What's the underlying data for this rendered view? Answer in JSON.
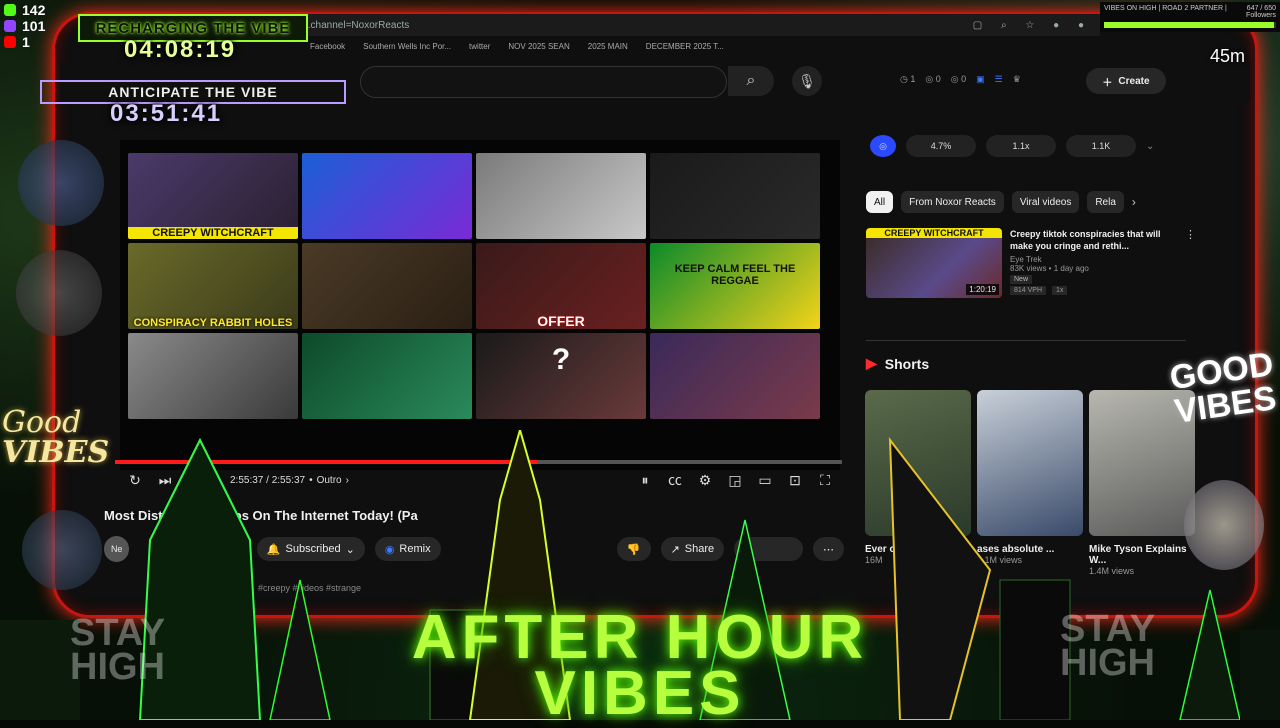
{
  "stream": {
    "viewer_counts": [
      "142",
      "101",
      "1"
    ],
    "recharging_label": "RECHARGING THE VIBE",
    "recharging_timer": "04:08:19",
    "anticipate_label": "ANTICIPATE THE VIBE",
    "anticipate_timer": "03:51:41",
    "minutes_label": "45m",
    "top_right_text": "VIBES ON HIGH | ROAD 2 PARTNER |",
    "top_right_followers": "647 / 650 Followers",
    "good_vibes_left": [
      "Good",
      "VIBES"
    ],
    "good_vibes_right": [
      "GOOD",
      "VIBES"
    ],
    "after_hours": [
      "AFTER HOUR",
      "VIBES"
    ],
    "stay_high_left": [
      "STAY",
      "HIGH"
    ],
    "stay_high_right": [
      "STAY",
      "HIGH"
    ]
  },
  "browser": {
    "url": "ld.channel=NoxorReacts",
    "bookmarks": [
      "Facebook",
      "Southern Wells Inc Por...",
      "twitter",
      "NOV 2025 SEAN",
      "2025 MAIN",
      "DECEMBER 2025 T..."
    ]
  },
  "youtube": {
    "header_stats": [
      "1",
      "0",
      "0"
    ],
    "create_label": "Create",
    "video_grid": [
      {
        "caption": "CREEPY WITCHCRAFT",
        "colors": [
          "#4a3a6a",
          "#2a2030"
        ]
      },
      {
        "caption": "",
        "colors": [
          "#1b5fd6",
          "#7a2ad6"
        ]
      },
      {
        "caption": "",
        "colors": [
          "#7a7a7a",
          "#c8c8c8"
        ]
      },
      {
        "caption": "",
        "colors": [
          "#1a1a1a",
          "#2a2a2a"
        ]
      },
      {
        "caption": "CONSPIRACY RABBIT HOLES",
        "colors": [
          "#6a6a2a",
          "#3a3a1a"
        ]
      },
      {
        "caption": "",
        "colors": [
          "#4a3a26",
          "#2a1f14"
        ]
      },
      {
        "caption": "OFFER",
        "colors": [
          "#3a1a1a",
          "#6a2020"
        ]
      },
      {
        "caption": "KEEP CALM FEEL THE REGGAE",
        "colors": [
          "#0b8a2a",
          "#f4d31a"
        ]
      },
      {
        "caption": "",
        "colors": [
          "#8a8a8a",
          "#3a3a3a"
        ]
      },
      {
        "caption": "",
        "colors": [
          "#0d4a2a",
          "#2a8a5a"
        ]
      },
      {
        "caption": "?",
        "colors": [
          "#1a1a1a",
          "#6a3a3a"
        ]
      },
      {
        "caption": "",
        "colors": [
          "#3a2a5a",
          "#7a3a4a"
        ]
      }
    ],
    "time_display": "2:55:37 / 2:55:37",
    "chapter": "Outro",
    "progress_fraction": 0.58,
    "video_title": "Most Disturbing Videos On The Internet Today! (Pa",
    "channel_initial": "Ne",
    "subscribed_label": "Subscribed",
    "remix_label": "Remix",
    "share_label": "Share",
    "hashtags": "#creepy #videos #strange",
    "right_stats": [
      "4.7%",
      "1.1x",
      "1.1K"
    ],
    "chips": [
      "All",
      "From Noxor Reacts",
      "Viral videos",
      "Rela"
    ],
    "recommended": {
      "caption": "CREEPY WITCHCRAFT",
      "title": "Creepy tiktok conspiracies that will make you cringe and rethi...",
      "channel": "Eye Trek",
      "meta": "83K views • 1 day ago",
      "badge": "New",
      "duration": "1:20:19",
      "extra": "814 VPH",
      "extra2": "1x"
    },
    "shorts_label": "Shorts",
    "shorts": [
      {
        "title": "Ever could...",
        "views": "16M",
        "colors": [
          "#5a6a4a",
          "#2a3a2a"
        ]
      },
      {
        "title": "ases absolute ...",
        "views": "4.1M views",
        "colors": [
          "#c8d0d8",
          "#3a4a6a"
        ]
      },
      {
        "title": "Mike Tyson Explains W...",
        "views": "1.4M views",
        "colors": [
          "#b8b8b0",
          "#5a5a5a"
        ]
      }
    ]
  }
}
